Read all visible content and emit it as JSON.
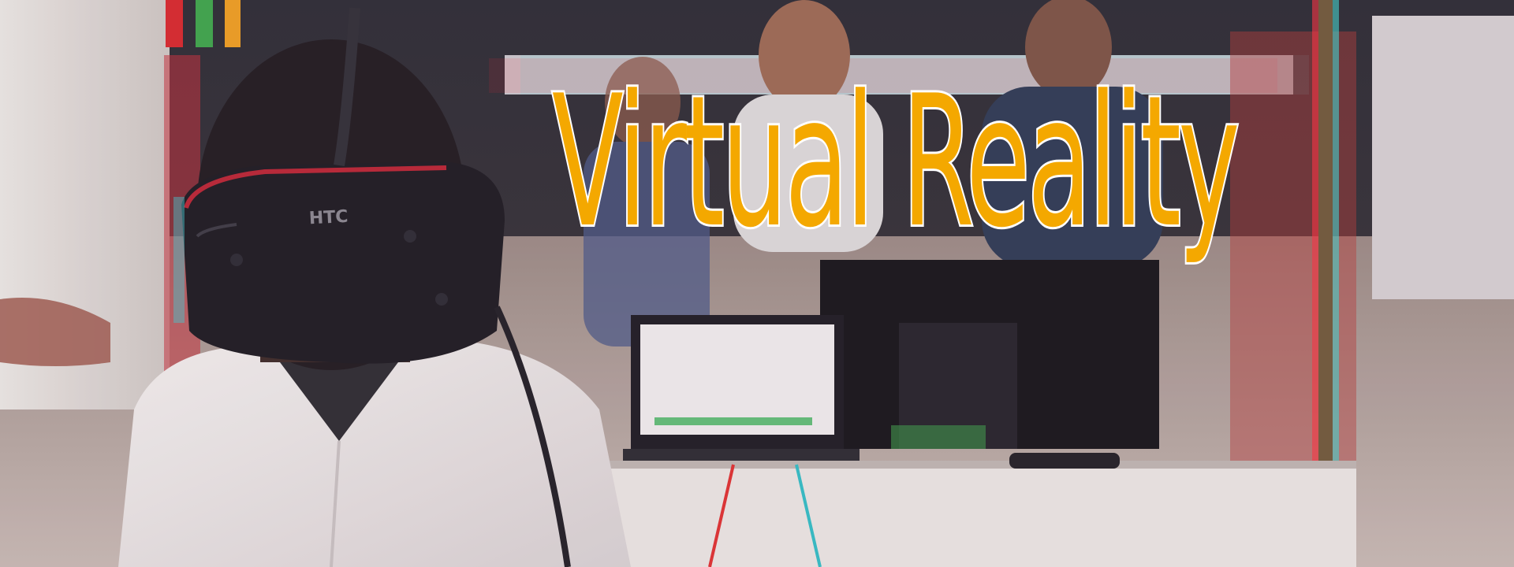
{
  "banner": {
    "title": "Virtual Reality",
    "title_color": "#f4a800",
    "title_outline_color": "#ffffff"
  },
  "photo": {
    "headset_brand": "HTC",
    "style": "red-cyan chromatic aberration"
  }
}
